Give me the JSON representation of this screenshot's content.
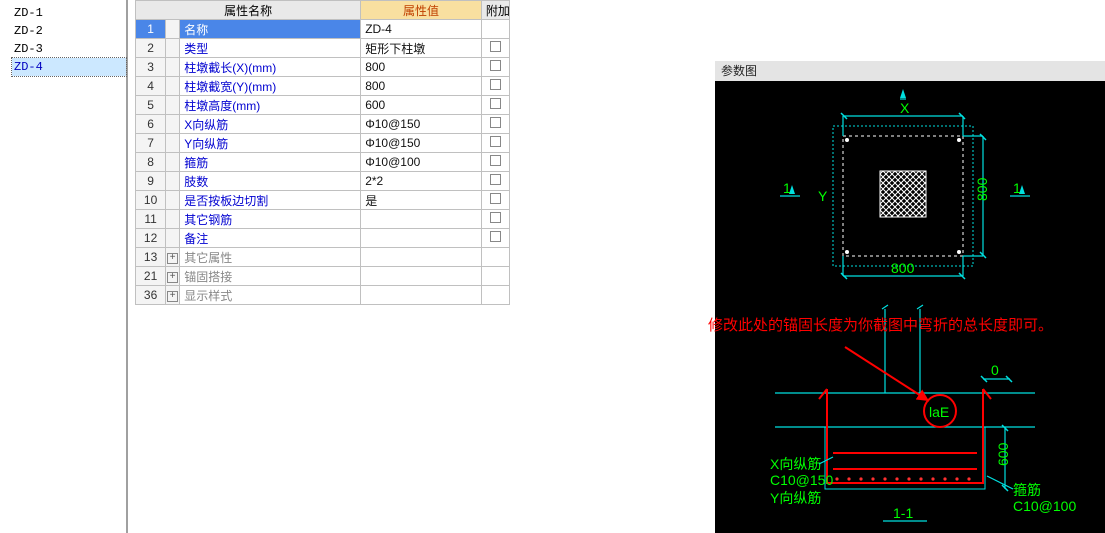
{
  "tree": {
    "items": [
      "ZD-1",
      "ZD-2",
      "ZD-3",
      "ZD-4"
    ],
    "selected_index": 3
  },
  "grid": {
    "headers": {
      "name": "属性名称",
      "value": "属性值",
      "extra": "附加"
    },
    "rows": [
      {
        "num": "1",
        "name": "名称",
        "value": "ZD-4",
        "check": false,
        "selected": true,
        "link": true
      },
      {
        "num": "2",
        "name": "类型",
        "value": "矩形下柱墩",
        "check": true,
        "link": true
      },
      {
        "num": "3",
        "name": "柱墩截长(X)(mm)",
        "value": "800",
        "check": true,
        "link": true
      },
      {
        "num": "4",
        "name": "柱墩截宽(Y)(mm)",
        "value": "800",
        "check": true,
        "link": true
      },
      {
        "num": "5",
        "name": "柱墩高度(mm)",
        "value": "600",
        "check": true,
        "link": true
      },
      {
        "num": "6",
        "name": "X向纵筋",
        "value": "Φ10@150",
        "check": true,
        "link": true
      },
      {
        "num": "7",
        "name": "Y向纵筋",
        "value": "Φ10@150",
        "check": true,
        "link": true
      },
      {
        "num": "8",
        "name": "箍筋",
        "value": "Φ10@100",
        "check": true,
        "link": true
      },
      {
        "num": "9",
        "name": "肢数",
        "value": "2*2",
        "check": true,
        "link": true
      },
      {
        "num": "10",
        "name": "是否按板边切割",
        "value": "是",
        "check": true,
        "link": true
      },
      {
        "num": "11",
        "name": "其它钢筋",
        "value": "",
        "check": true,
        "link": true
      },
      {
        "num": "12",
        "name": "备注",
        "value": "",
        "check": true,
        "link": true
      },
      {
        "num": "13",
        "name": "其它属性",
        "value": "",
        "check": false,
        "expand": true,
        "gray": true
      },
      {
        "num": "21",
        "name": "锚固搭接",
        "value": "",
        "check": false,
        "expand": true,
        "gray": true
      },
      {
        "num": "36",
        "name": "显示样式",
        "value": "",
        "check": false,
        "expand": true,
        "gray": true
      }
    ]
  },
  "diagram": {
    "title": "参数图",
    "labels": {
      "X": "X",
      "Y": "Y",
      "width": "800",
      "height": "800",
      "one_a": "1",
      "one_b": "1",
      "zero": "0",
      "laE": "laE",
      "x_rein_label": "X向纵筋",
      "x_rein_val": "C10@150",
      "y_rein_label": "Y向纵筋",
      "stirrup_label": "箍筋",
      "stirrup_val": "C10@100",
      "section_tag": "1-1",
      "sect_h": "600"
    }
  },
  "annotation": "修改此处的锚固长度为你截图中弯折的总长度即可。"
}
